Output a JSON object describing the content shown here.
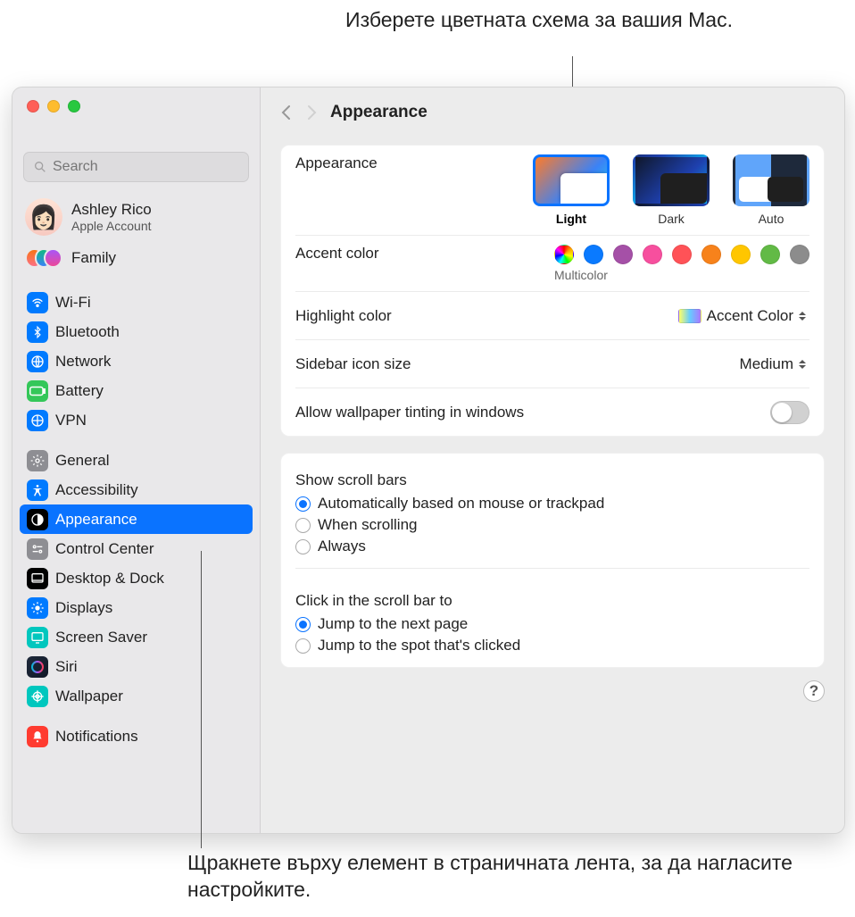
{
  "callouts": {
    "top": "Изберете цветната схема за вашия Mac.",
    "bottom": "Щракнете върху елемент в страничната лента, за да нагласите настройките."
  },
  "search": {
    "placeholder": "Search"
  },
  "account": {
    "name": "Ashley Rico",
    "sub": "Apple Account"
  },
  "family": {
    "label": "Family"
  },
  "sidebar": {
    "groups": [
      [
        {
          "label": "Wi-Fi",
          "icon": "wifi"
        },
        {
          "label": "Bluetooth",
          "icon": "bt"
        },
        {
          "label": "Network",
          "icon": "net"
        },
        {
          "label": "Battery",
          "icon": "batt"
        },
        {
          "label": "VPN",
          "icon": "vpn"
        }
      ],
      [
        {
          "label": "General",
          "icon": "gen"
        },
        {
          "label": "Accessibility",
          "icon": "access"
        },
        {
          "label": "Appearance",
          "icon": "appear",
          "selected": true
        },
        {
          "label": "Control Center",
          "icon": "cc"
        },
        {
          "label": "Desktop & Dock",
          "icon": "dock"
        },
        {
          "label": "Displays",
          "icon": "disp"
        },
        {
          "label": "Screen Saver",
          "icon": "ss"
        },
        {
          "label": "Siri",
          "icon": "siri"
        },
        {
          "label": "Wallpaper",
          "icon": "wall"
        }
      ],
      [
        {
          "label": "Notifications",
          "icon": "notif"
        }
      ]
    ]
  },
  "content": {
    "title": "Appearance",
    "appearance": {
      "label": "Appearance",
      "options": [
        {
          "label": "Light",
          "kind": "light",
          "selected": true
        },
        {
          "label": "Dark",
          "kind": "dark"
        },
        {
          "label": "Auto",
          "kind": "auto"
        }
      ]
    },
    "accent": {
      "label": "Accent color",
      "selected_label": "Multicolor",
      "colors": [
        "multi",
        "blue",
        "purple",
        "pink",
        "red",
        "orange",
        "yellow",
        "green",
        "gray"
      ]
    },
    "highlight": {
      "label": "Highlight color",
      "value": "Accent Color"
    },
    "sidebar_size": {
      "label": "Sidebar icon size",
      "value": "Medium"
    },
    "tinting": {
      "label": "Allow wallpaper tinting in windows",
      "value": false
    },
    "scrollbars": {
      "title": "Show scroll bars",
      "options": [
        {
          "label": "Automatically based on mouse or trackpad",
          "checked": true
        },
        {
          "label": "When scrolling"
        },
        {
          "label": "Always"
        }
      ]
    },
    "click_scroll": {
      "title": "Click in the scroll bar to",
      "options": [
        {
          "label": "Jump to the next page",
          "checked": true
        },
        {
          "label": "Jump to the spot that's clicked"
        }
      ]
    },
    "help": "?"
  }
}
